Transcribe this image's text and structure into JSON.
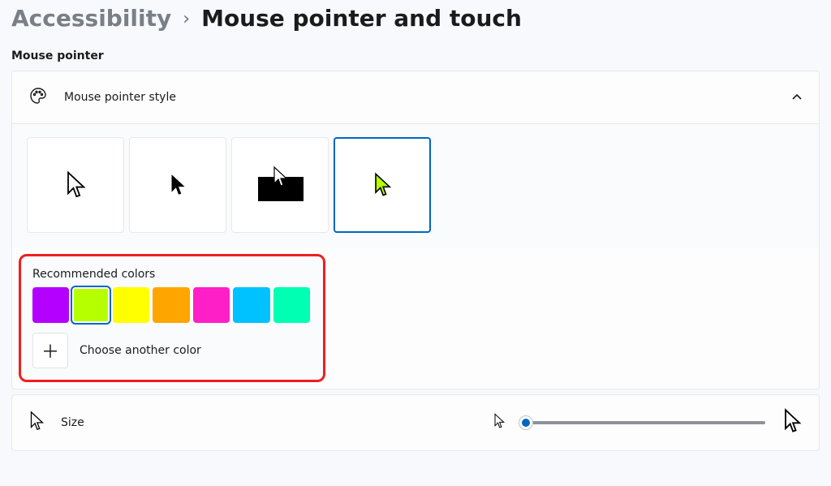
{
  "breadcrumb": {
    "parent": "Accessibility",
    "separator": "›",
    "current": "Mouse pointer and touch"
  },
  "section_heading": "Mouse pointer",
  "style_panel": {
    "title": "Mouse pointer style",
    "styles": [
      {
        "id": "white",
        "selected": false
      },
      {
        "id": "black",
        "selected": false
      },
      {
        "id": "inverted",
        "selected": false
      },
      {
        "id": "custom",
        "selected": true,
        "cursor_color": "#b6ff00"
      }
    ],
    "recommended_label": "Recommended colors",
    "recommended_colors": [
      {
        "hex": "#b400ff",
        "selected": false
      },
      {
        "hex": "#b6ff00",
        "selected": true
      },
      {
        "hex": "#ffff00",
        "selected": false
      },
      {
        "hex": "#ffa500",
        "selected": false
      },
      {
        "hex": "#ff1fc6",
        "selected": false
      },
      {
        "hex": "#00c2ff",
        "selected": false
      },
      {
        "hex": "#00ffb3",
        "selected": false
      }
    ],
    "choose_label": "Choose another color"
  },
  "size_panel": {
    "title": "Size",
    "slider": {
      "min": 1,
      "max": 15,
      "value": 1
    }
  }
}
